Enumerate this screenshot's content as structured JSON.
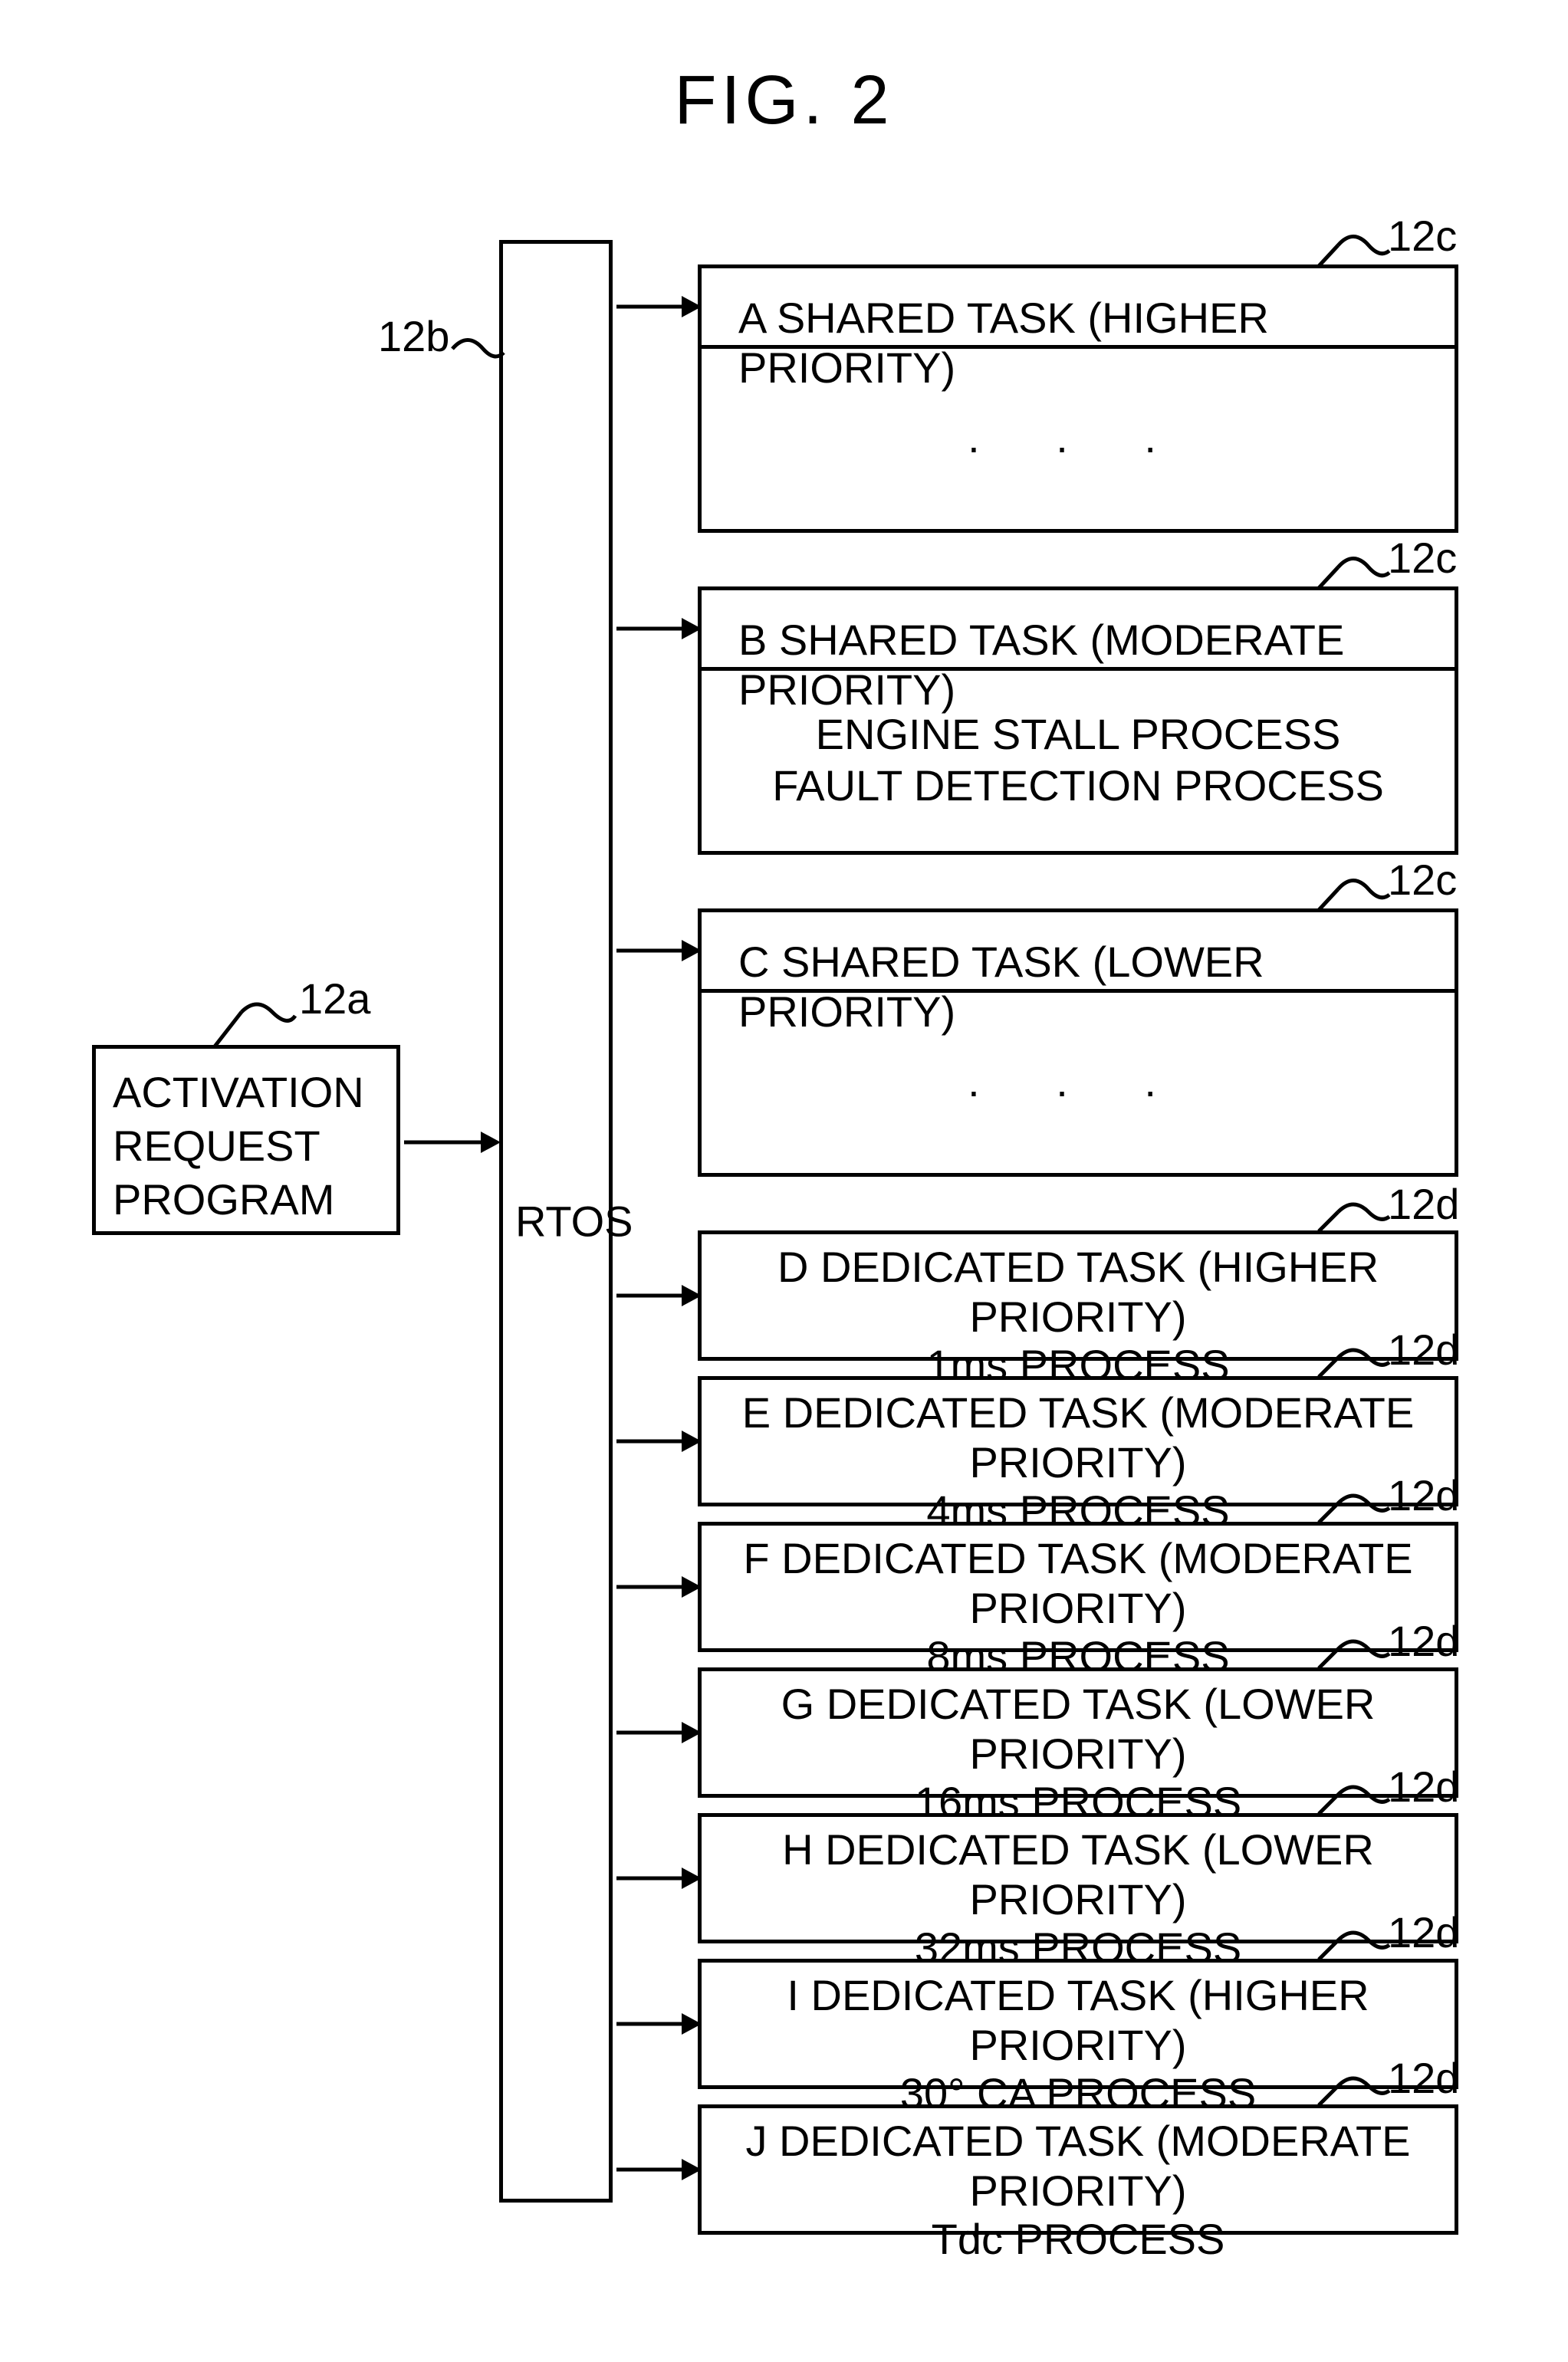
{
  "figure_title": "FIG. 2",
  "labels": {
    "ref_12a": "12a",
    "ref_12b": "12b",
    "ref_12c": "12c",
    "ref_12d": "12d"
  },
  "activation": {
    "line1": "ACTIVATION",
    "line2": "REQUEST",
    "line3": "PROGRAM"
  },
  "rtos": "RTOS",
  "tasks": {
    "A": {
      "title": "A SHARED TASK (HIGHER PRIORITY)",
      "body_lines": [
        ". . ."
      ]
    },
    "B": {
      "title": "B SHARED TASK (MODERATE PRIORITY)",
      "body_lines": [
        "ENGINE STALL PROCESS",
        "FAULT DETECTION PROCESS"
      ]
    },
    "C": {
      "title": "C SHARED TASK (LOWER PRIORITY)",
      "body_lines": [
        ". . ."
      ]
    },
    "D": {
      "title": "D DEDICATED TASK (HIGHER PRIORITY)",
      "subtitle": "1ms PROCESS"
    },
    "E": {
      "title": "E DEDICATED TASK (MODERATE PRIORITY)",
      "subtitle": "4ms PROCESS"
    },
    "F": {
      "title": "F DEDICATED TASK (MODERATE PRIORITY)",
      "subtitle": "8ms PROCESS"
    },
    "G": {
      "title": "G DEDICATED TASK (LOWER PRIORITY)",
      "subtitle": "16ms PROCESS"
    },
    "H": {
      "title": "H DEDICATED TASK (LOWER PRIORITY)",
      "subtitle": "32ms PROCESS"
    },
    "I": {
      "title": "I DEDICATED TASK (HIGHER PRIORITY)",
      "subtitle": "30° CA PROCESS"
    },
    "J": {
      "title": "J DEDICATED TASK (MODERATE PRIORITY)",
      "subtitle": "Tdc PROCESS"
    }
  }
}
